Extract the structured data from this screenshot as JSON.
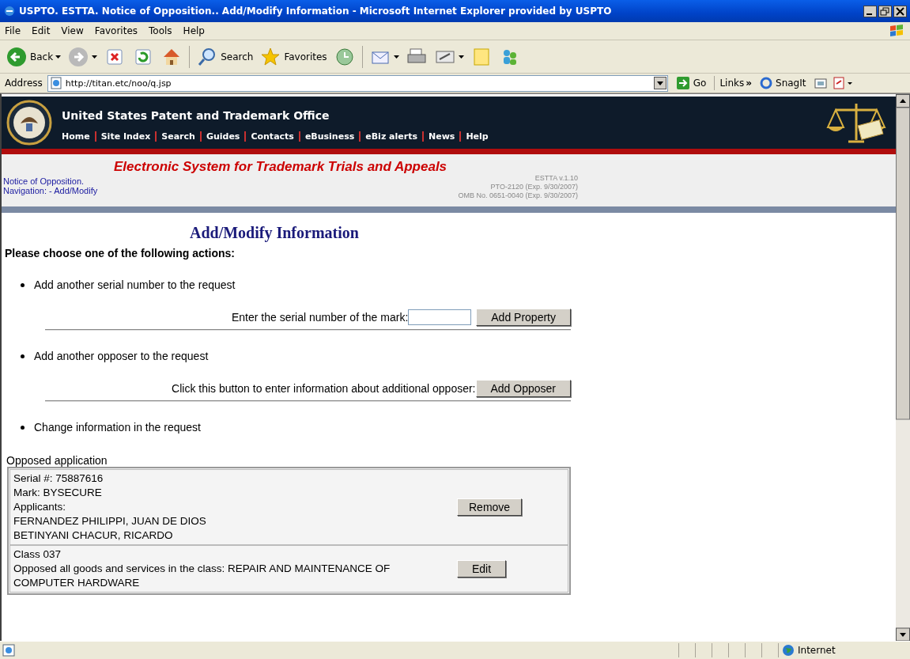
{
  "window": {
    "title": "USPTO. ESTTA. Notice of Opposition.. Add/Modify Information - Microsoft Internet Explorer provided by USPTO"
  },
  "menu": [
    "File",
    "Edit",
    "View",
    "Favorites",
    "Tools",
    "Help"
  ],
  "toolbar": [
    {
      "label": "Back",
      "dropdown": true
    },
    {
      "dropdown": true
    },
    {
      "dropdown": false
    },
    {
      "dropdown": false
    },
    {
      "dropdown": false
    },
    {
      "label": "Search",
      "dropdown": false
    },
    {
      "label": "Favorites",
      "dropdown": false
    },
    {
      "dropdown": false
    },
    {
      "dropdown": true
    },
    {
      "dropdown": false
    },
    {
      "dropdown": true
    },
    {
      "dropdown": false
    },
    {
      "dropdown": false
    }
  ],
  "address_bar": {
    "label": "Address",
    "value": "http://titan.etc/noo/q.jsp",
    "go": "Go",
    "links": "Links",
    "chevron": "»",
    "snagit": "SnagIt"
  },
  "page": {
    "agency": "United States Patent and Trademark Office",
    "nav": [
      "Home",
      "Site Index",
      "Search",
      "Guides",
      "Contacts",
      "eBusiness",
      "eBiz alerts",
      "News",
      "Help"
    ],
    "system_title": "Electronic System for Trademark Trials and Appeals",
    "breadcrumb": [
      "Notice of Opposition.",
      "Navigation: - Add/Modify"
    ],
    "version": [
      "ESTTA v.1.10",
      "PTO-2120 (Exp. 9/30/2007)",
      "OMB No. 0651-0040 (Exp. 9/30/2007)"
    ],
    "heading": "Add/Modify Information",
    "instruction": "Please choose one of the following actions:",
    "actions": [
      {
        "text": "Add another serial number to the request",
        "prompt": "Enter the serial number of the mark:",
        "field": true,
        "button": "Add Property"
      },
      {
        "text": "Add another opposer to the request",
        "prompt": "Click this button to enter information about additional opposer:",
        "field": false,
        "button": "Add Opposer"
      },
      {
        "text": "Change information in the request"
      }
    ],
    "opposed_label": "Opposed application",
    "opposed_rows": [
      {
        "lines": [
          "Serial #: 75887616",
          "Mark: BYSECURE",
          "Applicants:",
          "FERNANDEZ PHILIPPI, JUAN DE DIOS",
          "BETINYANI CHACUR, RICARDO"
        ],
        "button": "Remove"
      },
      {
        "lines": [
          "Class 037",
          " Opposed all goods and services in the class: REPAIR AND MAINTENANCE OF COMPUTER HARDWARE"
        ],
        "button": "Edit"
      }
    ]
  },
  "status_bar": {
    "zone": "Internet"
  }
}
